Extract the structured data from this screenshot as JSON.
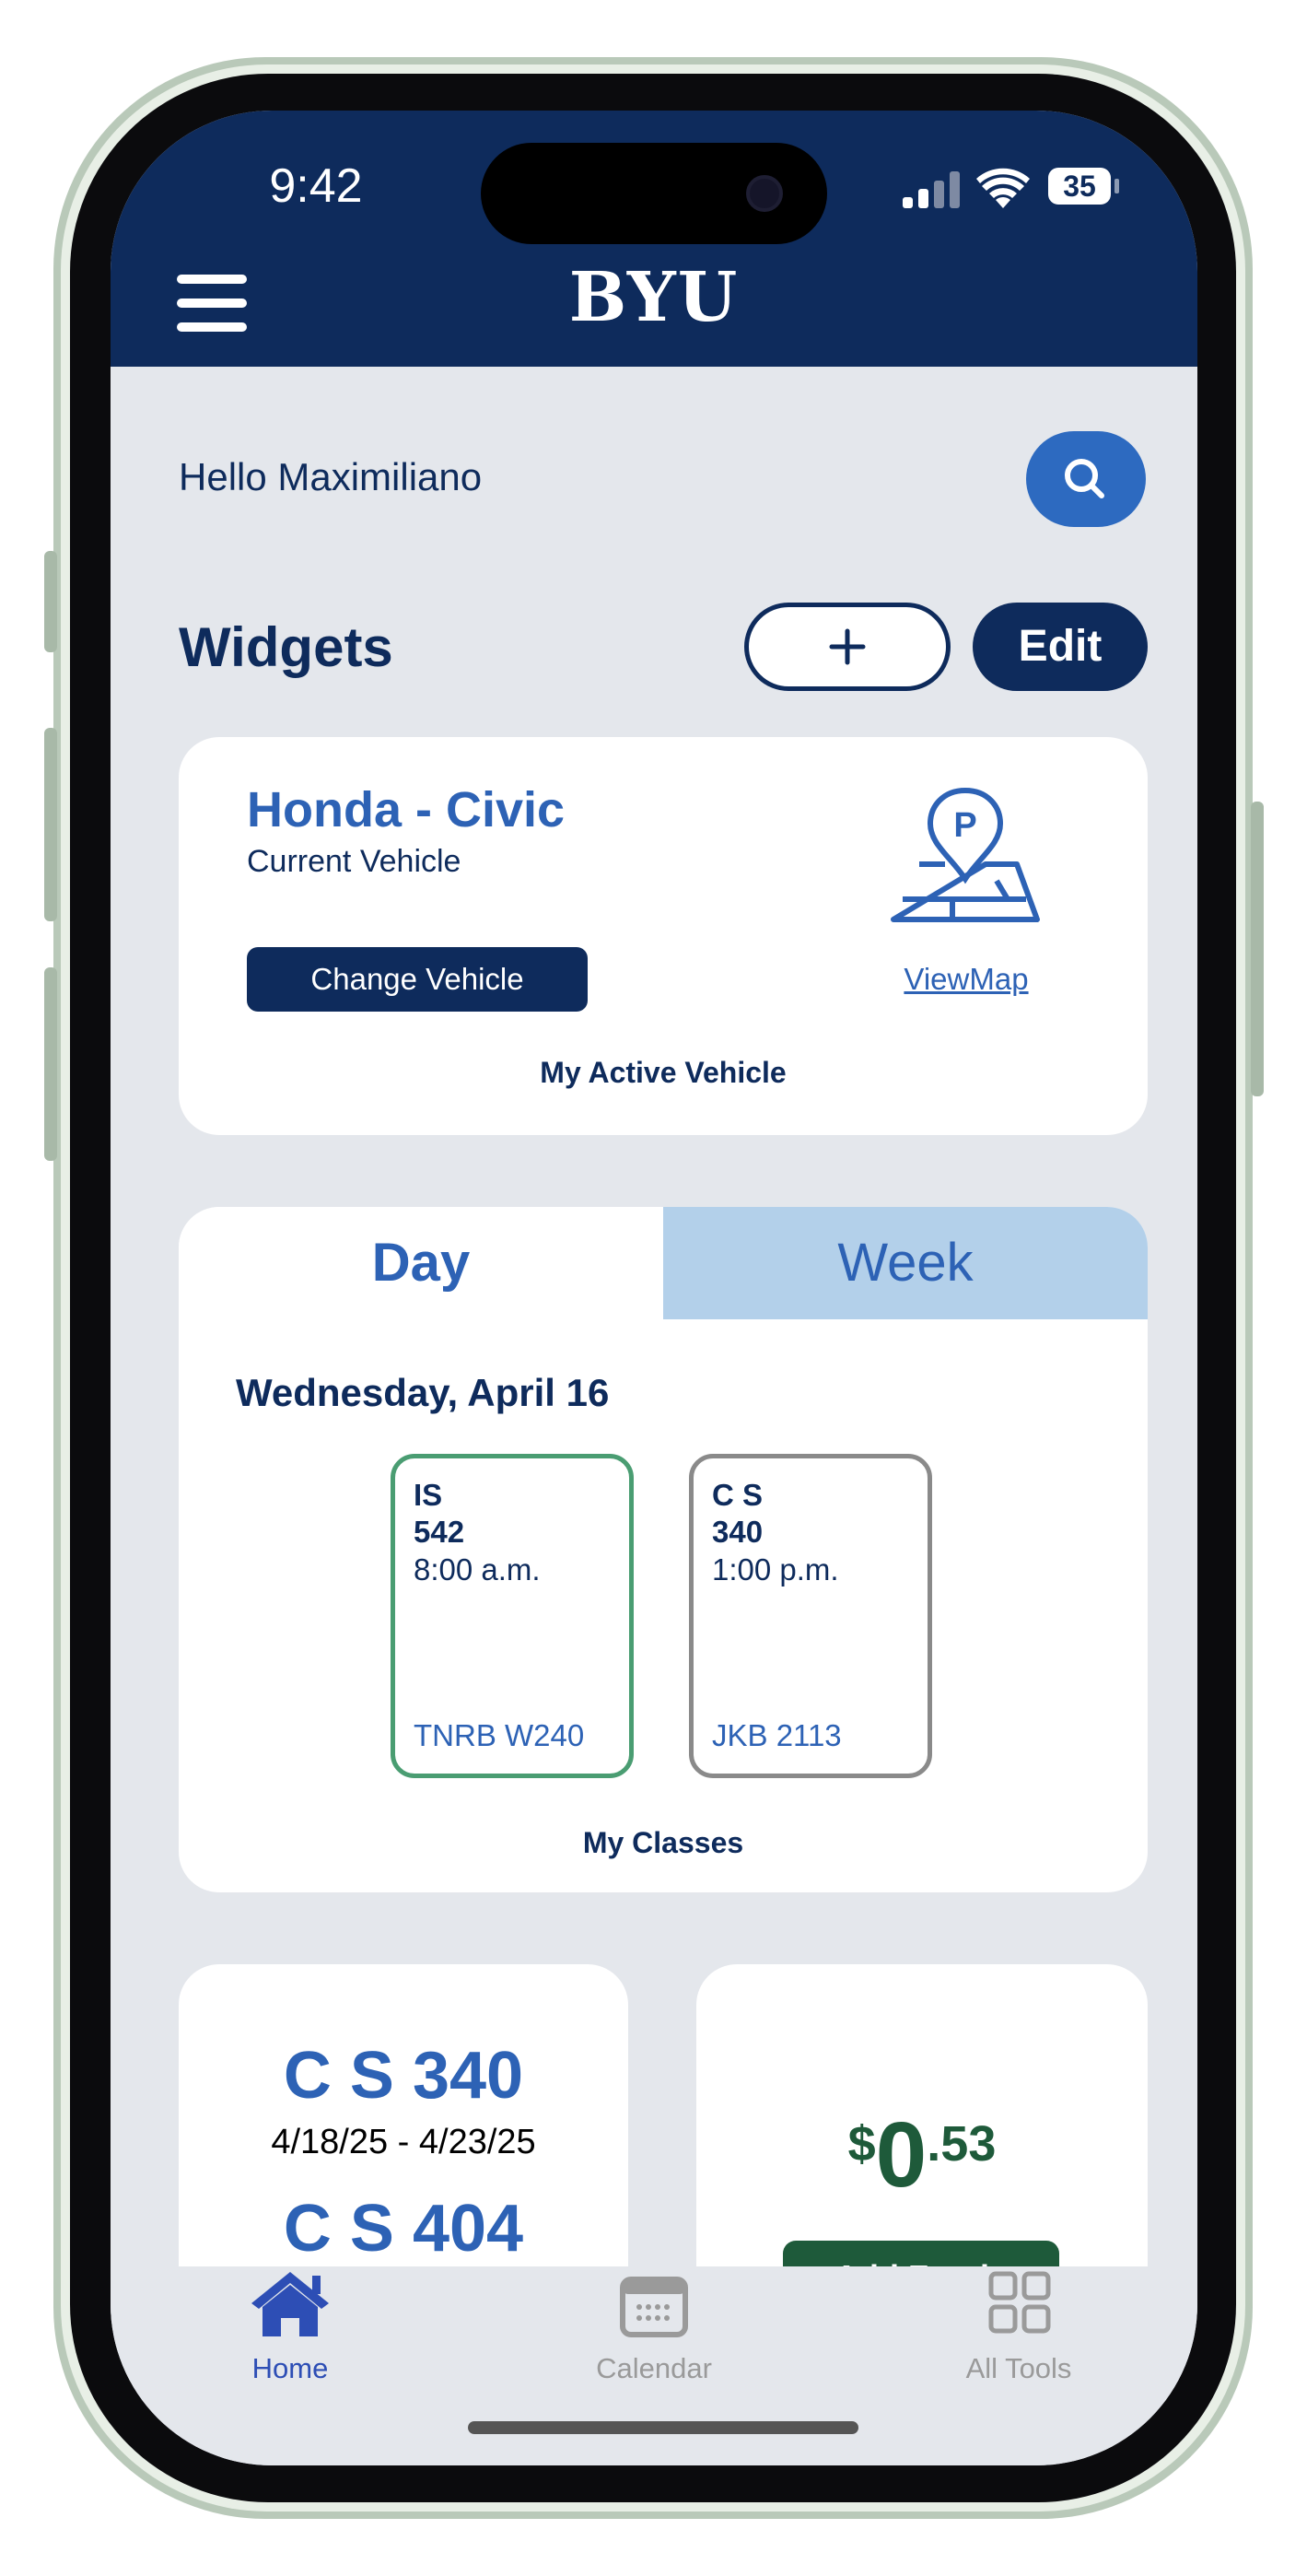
{
  "status_bar": {
    "time": "9:42",
    "battery": "35"
  },
  "header": {
    "logo": "BYU"
  },
  "greeting": "Hello Maximiliano",
  "widgets": {
    "title": "Widgets",
    "edit_label": "Edit"
  },
  "vehicle_widget": {
    "vehicle_name": "Honda - Civic",
    "subtitle": "Current Vehicle",
    "change_button": "Change Vehicle",
    "map_link": "ViewMap",
    "footer": "My Active Vehicle"
  },
  "classes_widget": {
    "tabs": [
      {
        "label": "Day",
        "active": true
      },
      {
        "label": "Week",
        "active": false
      }
    ],
    "date": "Wednesday, April 16",
    "classes": [
      {
        "dept": "IS",
        "number": "542",
        "time": "8:00 a.m.",
        "room": "TNRB W240",
        "border_color": "#4a9d72"
      },
      {
        "dept": "C S",
        "number": "340",
        "time": "1:00 p.m.",
        "room": "JKB 2113",
        "border_color": "#8a8a8a"
      }
    ],
    "footer": "My Classes"
  },
  "exams_widget": {
    "items": [
      {
        "course": "C S 340",
        "dates": "4/18/25 - 4/23/25"
      },
      {
        "course": "C S 404"
      }
    ]
  },
  "funds_widget": {
    "currency": "$",
    "dollars": "0",
    "cents": ".53",
    "button": "Add Funds"
  },
  "tab_bar": {
    "items": [
      {
        "label": "Home",
        "icon": "home-icon",
        "active": true
      },
      {
        "label": "Calendar",
        "icon": "calendar-icon",
        "active": false
      },
      {
        "label": "All Tools",
        "icon": "grid-icon",
        "active": false
      }
    ]
  },
  "colors": {
    "brand_navy": "#0e2b5c",
    "accent_blue": "#2d62b5",
    "funds_green": "#1e5a3a",
    "week_tab": "#b3d0ea"
  }
}
